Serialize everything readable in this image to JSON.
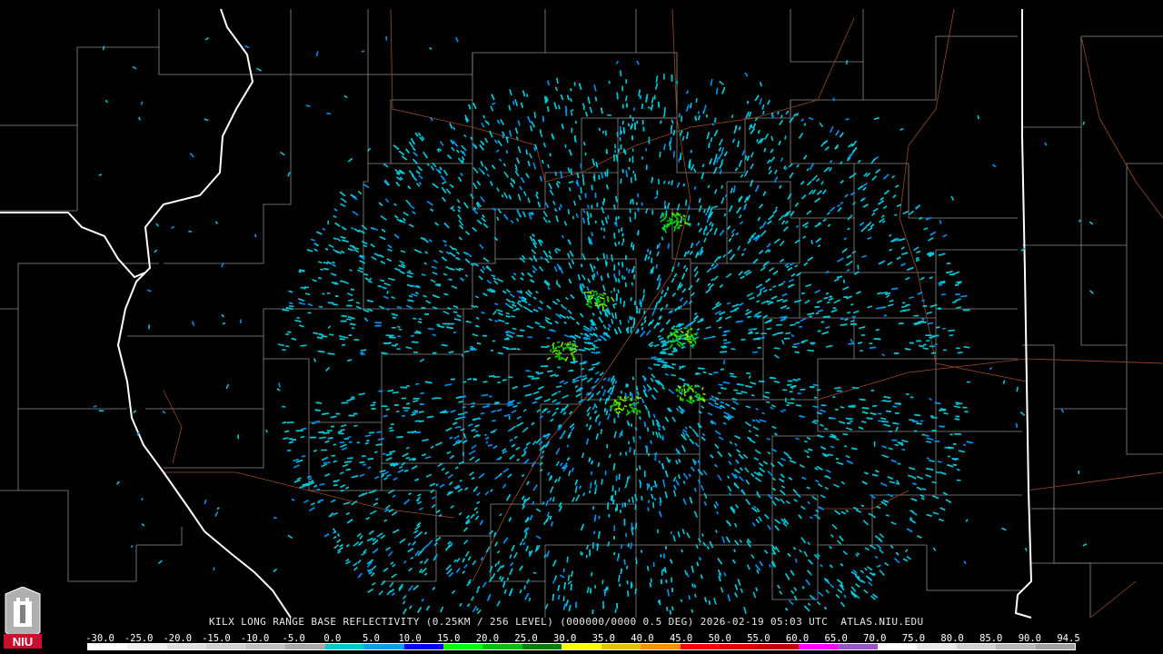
{
  "caption": "KILX LONG RANGE BASE REFLECTIVITY (0.25KM / 256 LEVEL) (000000/0000 0.5 DEG) 2026-02-19 05:03 UTC  ATLAS.NIU.EDU",
  "logo": {
    "text": "NIU",
    "icon": "niu-logo-icon"
  },
  "scale": {
    "labels": [
      "-30.0",
      "-25.0",
      "-20.0",
      "-15.0",
      "-10.0",
      "-5.0",
      "0.0",
      "5.0",
      "10.0",
      "15.0",
      "20.0",
      "25.0",
      "30.0",
      "35.0",
      "40.0",
      "45.0",
      "50.0",
      "55.0",
      "60.0",
      "65.0",
      "70.0",
      "75.0",
      "80.0",
      "85.0",
      "90.0",
      "94.5"
    ],
    "colors": [
      "#ffffff",
      "#f0f0f0",
      "#e0e0e0",
      "#d0d0d0",
      "#c0c0c0",
      "#a8a8a8",
      "#00c8c8",
      "#00a0f0",
      "#0000f0",
      "#00ff00",
      "#00c000",
      "#008000",
      "#ffff00",
      "#e8c000",
      "#ff9000",
      "#ff0000",
      "#d60000",
      "#c00000",
      "#ff00ff",
      "#9955c9",
      "#ffffff",
      "#e8e8e8",
      "#d0d0d0",
      "#b8b8b8",
      "#a0a0a0"
    ]
  },
  "colors": {
    "background": "#000000",
    "county_lines": "#8a8a8a",
    "state_lines": "#ffffff",
    "roads": "#a0522d",
    "echo_light": "#00c8d8",
    "echo_blue": "#0090f0",
    "echo_green": "#00d000"
  }
}
